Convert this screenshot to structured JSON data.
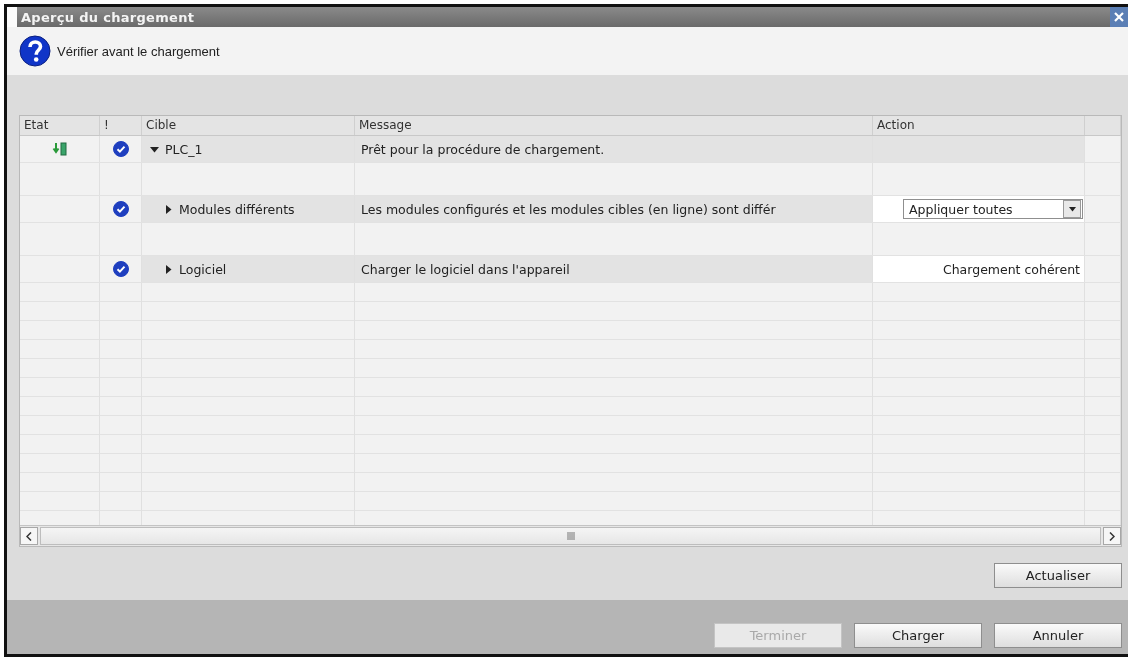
{
  "window": {
    "title": "Aperçu du chargement"
  },
  "header": {
    "text": "Vérifier avant le chargement"
  },
  "table": {
    "columns": [
      "Etat",
      "!",
      "Cible",
      "Message",
      "Action"
    ],
    "rows": [
      {
        "state_icon": true,
        "checked": true,
        "target": "PLC_1",
        "expanded": true,
        "message": "Prêt pour la procédure de chargement.",
        "action": {
          "kind": "none"
        },
        "children": [
          {
            "state_icon": false,
            "checked": true,
            "target": "Modules différents",
            "expanded": false,
            "message": "Les modules configurés et les modules cibles (en ligne) sont différ",
            "action": {
              "kind": "dropdown",
              "value": "Appliquer toutes"
            }
          },
          {
            "state_icon": false,
            "checked": true,
            "target": "Logiciel",
            "expanded": false,
            "message": "Charger le logiciel dans l'appareil",
            "action": {
              "kind": "text",
              "value": "Chargement cohérent"
            }
          }
        ]
      }
    ]
  },
  "refresh_button": {
    "label": "Actualiser"
  },
  "buttons": [
    {
      "label": "Terminer",
      "disabled": true
    },
    {
      "label": "Charger",
      "disabled": false
    },
    {
      "label": "Annuler",
      "disabled": false
    }
  ]
}
